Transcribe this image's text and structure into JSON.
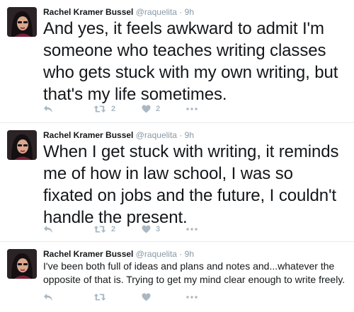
{
  "tweets": [
    {
      "author": "Rachel Kramer Bussel",
      "handle": "@raquelita",
      "separator": "·",
      "time": "9h",
      "text": "And yes, it feels awkward to admit I'm someone who teaches writing classes who gets stuck with my own writing, but that's my life sometimes.",
      "retweets": "2",
      "likes": "2"
    },
    {
      "author": "Rachel Kramer Bussel",
      "handle": "@raquelita",
      "separator": "·",
      "time": "9h",
      "text": "When I get stuck with writing, it reminds me of how in law school, I was so fixated on jobs and the future, I couldn't handle the present.",
      "retweets": "2",
      "likes": "3"
    },
    {
      "author": "Rachel Kramer Bussel",
      "handle": "@raquelita",
      "separator": "·",
      "time": "9h",
      "text": "I've been both full of ideas and plans and notes and...whatever the opposite of that is. Trying to get my mind clear enough to write freely.",
      "retweets": "",
      "likes": ""
    }
  ],
  "icons": {
    "reply": "reply-icon",
    "retweet": "retweet-icon",
    "like": "heart-icon",
    "more": "more-dots-icon"
  },
  "colors": {
    "action_gray": "#aab8c2",
    "meta_gray": "#8899a6",
    "divider": "#e6ecf0"
  }
}
